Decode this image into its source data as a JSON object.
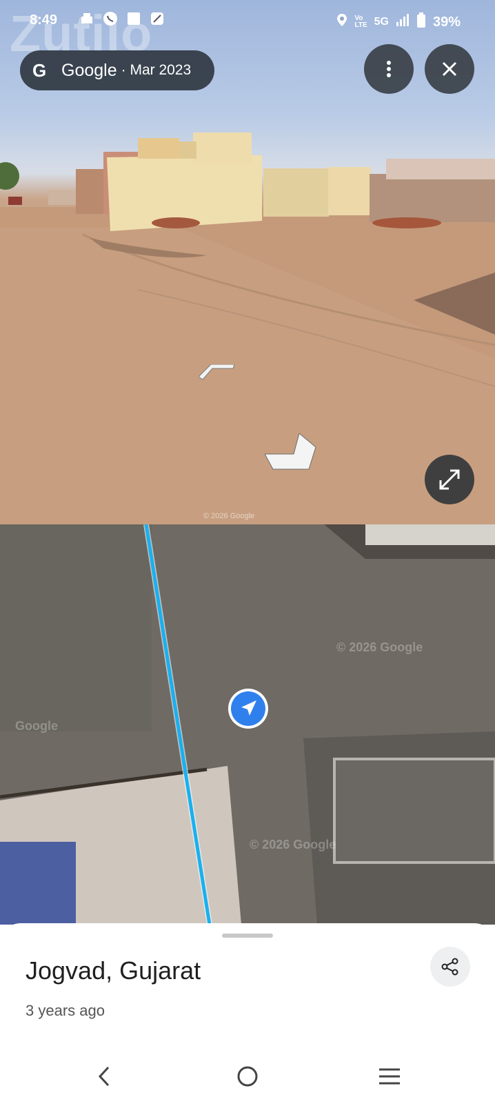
{
  "status_bar": {
    "time": "8:49",
    "network": "5G",
    "battery": "39%"
  },
  "watermark": "Zutilo",
  "streetview": {
    "source": "Google",
    "date": "· Mar 2023",
    "copyright": "© 2026 Google"
  },
  "map": {
    "copyright_1": "© 2026 Google",
    "copyright_2": "Google",
    "copyright_3": "© 2026 Google",
    "route_color": "#1ab0f0",
    "location_color": "#2f80ed"
  },
  "place": {
    "title": "Jogvad, Gujarat",
    "subtitle": "3 years ago"
  },
  "icons": {
    "more": "more-vert-icon",
    "close": "close-icon",
    "expand": "expand-icon",
    "share": "share-icon",
    "back": "back-icon",
    "home": "home-icon",
    "recents": "recents-icon"
  }
}
